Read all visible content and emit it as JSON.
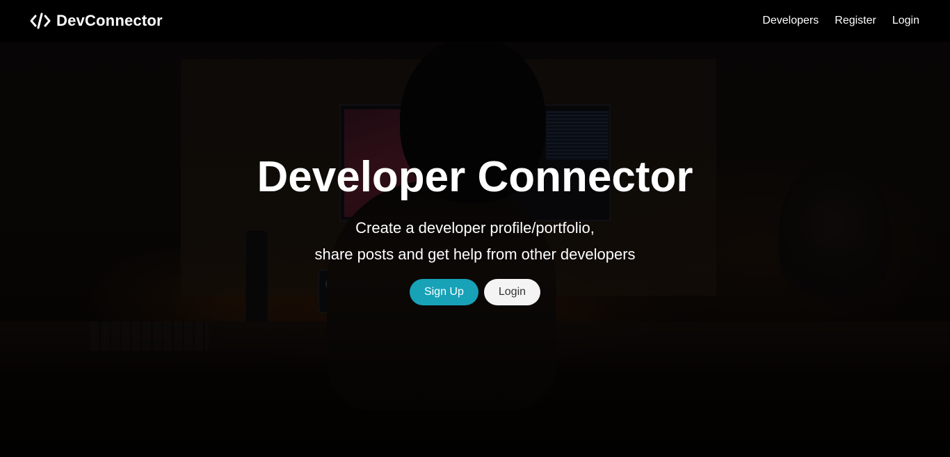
{
  "navbar": {
    "brand_icon": "code-icon",
    "brand_text": "DevConnector",
    "links": [
      {
        "label": "Developers"
      },
      {
        "label": "Register"
      },
      {
        "label": "Login"
      }
    ]
  },
  "hero": {
    "title": "Developer Connector",
    "lead_line1": "Create a developer profile/portfolio,",
    "lead_line2": "share posts and get help from other developers",
    "buttons": {
      "signup": "Sign Up",
      "login": "Login"
    }
  },
  "colors": {
    "navbar_bg": "#000000",
    "primary": "#17a2b8",
    "light": "#f4f4f4",
    "text": "#ffffff"
  }
}
